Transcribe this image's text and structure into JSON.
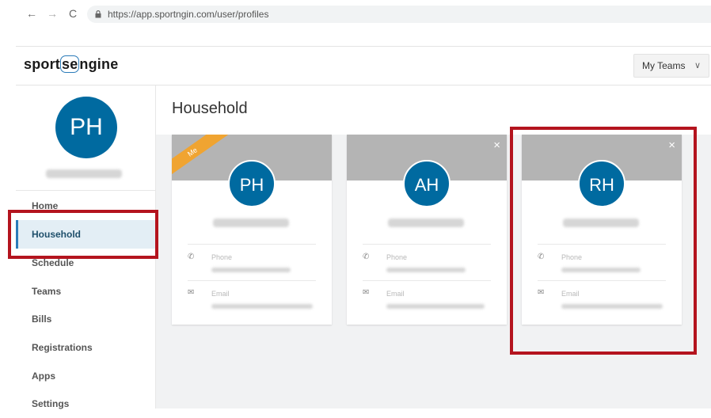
{
  "browser": {
    "url": "https://app.sportngin.com/user/profiles",
    "back": "←",
    "forward": "→",
    "reload": "C"
  },
  "header": {
    "logo_pre": "sport",
    "logo_mid": "se",
    "logo_post": "ngine",
    "my_teams": "My Teams",
    "chevron": "∨"
  },
  "sidebar": {
    "avatar": "PH",
    "items": [
      {
        "label": "Home"
      },
      {
        "label": "Household"
      },
      {
        "label": "Schedule"
      },
      {
        "label": "Teams"
      },
      {
        "label": "Bills"
      },
      {
        "label": "Registrations"
      },
      {
        "label": "Apps"
      },
      {
        "label": "Settings"
      }
    ]
  },
  "main": {
    "title": "Household",
    "cards": [
      {
        "initials": "PH",
        "ribbon": "Me",
        "phone_label": "Phone",
        "email_label": "Email"
      },
      {
        "initials": "AH",
        "close": "×",
        "phone_label": "Phone",
        "email_label": "Email"
      },
      {
        "initials": "RH",
        "close": "×",
        "phone_label": "Phone",
        "email_label": "Email"
      }
    ]
  },
  "colors": {
    "avatar_blue": "#006aa0",
    "banner_gray": "#b4b4b4",
    "me_ribbon": "#f0a431",
    "highlight_red": "#b4141e"
  }
}
